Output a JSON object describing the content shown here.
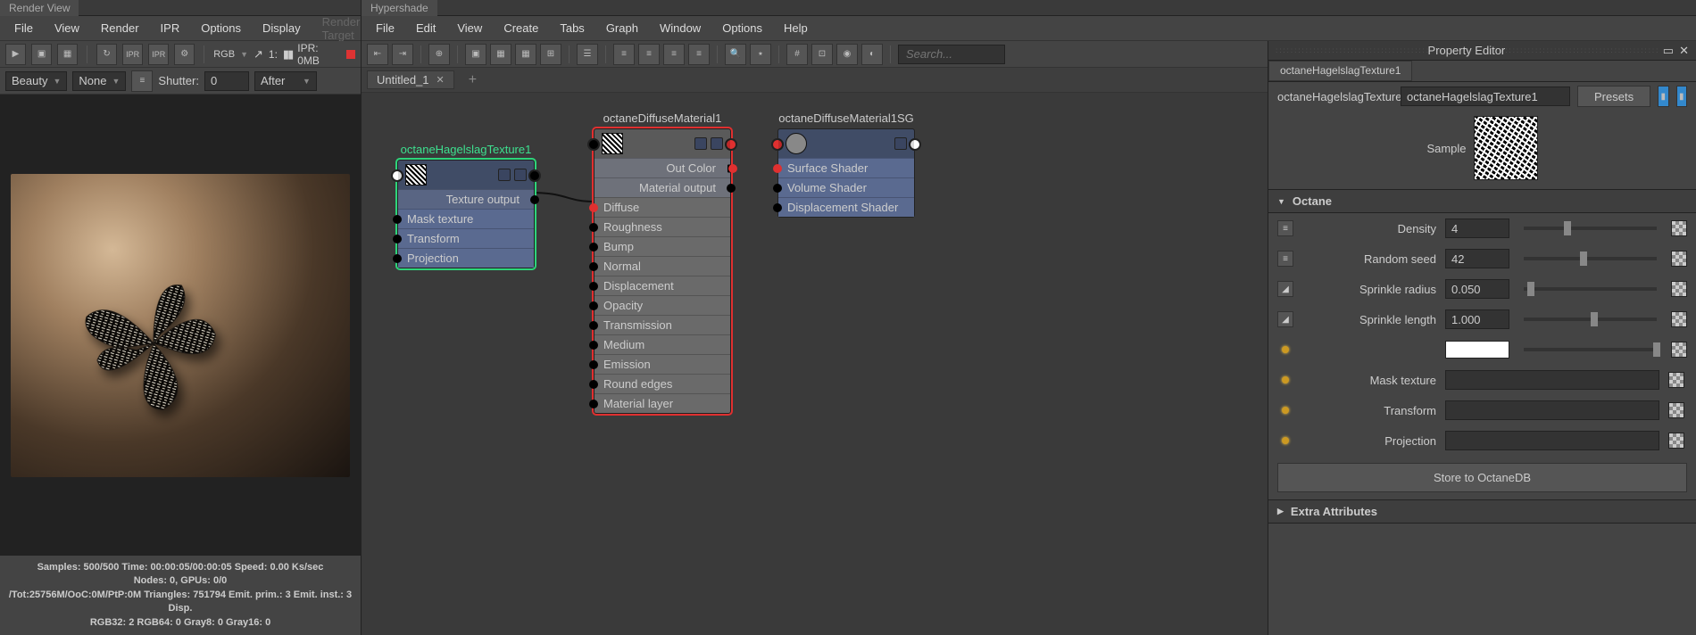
{
  "render_view": {
    "tab": "Render View",
    "menu": [
      "File",
      "View",
      "Render",
      "IPR",
      "Options",
      "Display",
      "Render Target"
    ],
    "toolbar2": {
      "channel": "RGB",
      "scale_icon": "↗",
      "exposure": "1:",
      "ipr_label": "IPR: 0MB"
    },
    "toolbar3": {
      "pass": "Beauty",
      "layer": "None",
      "shutter_label": "Shutter:",
      "shutter_val": "0",
      "timing": "After"
    },
    "stats": [
      "Samples: 500/500 Time: 00:00:05/00:00:05 Speed: 0.00 Ks/sec",
      "Nodes: 0, GPUs: 0/0",
      "/Tot:25756M/OoC:0M/PtP:0M Triangles: 751794 Emit. prim.: 3 Emit. inst.: 3 Disp.",
      "RGB32: 2 RGB64: 0 Gray8: 0 Gray16: 0"
    ]
  },
  "hypershade": {
    "tab": "Hypershade",
    "menu": [
      "File",
      "Edit",
      "View",
      "Create",
      "Tabs",
      "Graph",
      "Window",
      "Options",
      "Help"
    ],
    "file_tab": "Untitled_1",
    "search_placeholder": "Search..."
  },
  "nodes": {
    "tex": {
      "title": "octaneHagelslagTexture1",
      "out": "Texture output",
      "rows": [
        "Mask texture",
        "Transform",
        "Projection"
      ]
    },
    "mat": {
      "title": "octaneDiffuseMaterial1",
      "outs": [
        "Out Color",
        "Material output"
      ],
      "rows": [
        "Diffuse",
        "Roughness",
        "Bump",
        "Normal",
        "Displacement",
        "Opacity",
        "Transmission",
        "Medium",
        "Emission",
        "Round edges",
        "Material layer"
      ]
    },
    "sg": {
      "title": "octaneDiffuseMaterial1SG",
      "rows": [
        "Surface Shader",
        "Volume Shader",
        "Displacement Shader"
      ]
    }
  },
  "prop": {
    "header": "Property Editor",
    "tab": "octaneHagelslagTexture1",
    "name_label": "octaneHagelslagTexture:",
    "name_value": "octaneHagelslagTexture1",
    "presets": "Presets",
    "sample_label": "Sample",
    "section1": "Octane",
    "attrs": {
      "density_l": "Density",
      "density_v": "4",
      "seed_l": "Random seed",
      "seed_v": "42",
      "radius_l": "Sprinkle radius",
      "radius_v": "0.050",
      "length_l": "Sprinkle length",
      "length_v": "1.000",
      "mask_l": "Mask texture",
      "transform_l": "Transform",
      "projection_l": "Projection"
    },
    "store_btn": "Store to OctaneDB",
    "section2": "Extra Attributes"
  }
}
